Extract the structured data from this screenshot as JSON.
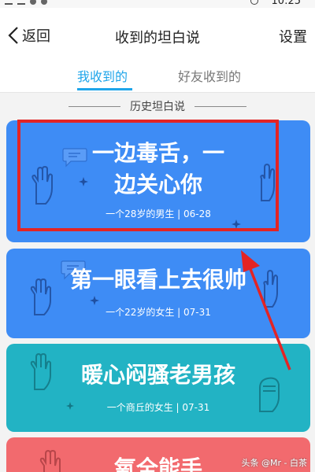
{
  "statusbar": {
    "time": "10:25"
  },
  "nav": {
    "back_label": "返回",
    "title": "收到的坦白说",
    "settings_label": "设置"
  },
  "tabs": {
    "mine": "我收到的",
    "friends": "好友收到的"
  },
  "section_header": "历史坦白说",
  "cards": [
    {
      "line1": "一边毒舌，一",
      "line2": "边关心你",
      "meta": "一个28岁的男生 | 06-28",
      "color": "#3e8cf5"
    },
    {
      "line1": "第一眼看上去很帅",
      "meta": "一个22岁的女生 | 07-31",
      "color": "#3e8cf5"
    },
    {
      "line1": "暖心闷骚老男孩",
      "meta": "一个商丘的女生 | 07-31",
      "color": "#22b3c4"
    },
    {
      "line1": "氧全能手",
      "color": "#f26a6e"
    }
  ],
  "colors": {
    "accent": "#1ea5ea",
    "annotation": "#e32424"
  },
  "watermark": "头条 @Mr - 白茶"
}
